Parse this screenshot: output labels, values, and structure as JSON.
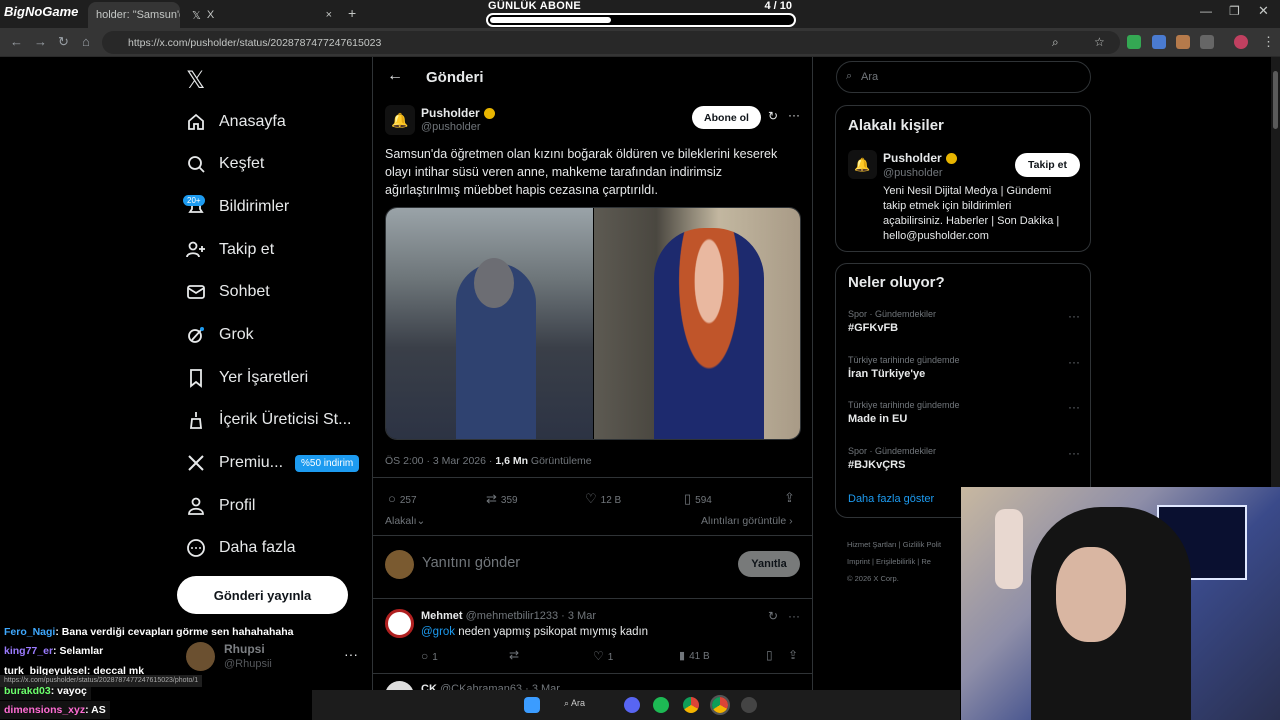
{
  "browser": {
    "tabs": [
      {
        "label": "holder: \"Samsun'da",
        "close": "×"
      },
      {
        "label": "X",
        "close": "×"
      }
    ],
    "new_tab": "+",
    "url": "https://x.com/pusholder/status/2028787477247615023",
    "status_url": "https://x.com/pusholder/status/2028787477247615023/photo/1",
    "overlay_logo": "BigNoGame"
  },
  "subs_goal": {
    "label": "GÜNLÜK ABONE",
    "count": "4  / 10",
    "progress": 0.4
  },
  "nav": {
    "logo": "𝕏",
    "items": [
      {
        "label": "Anasayfa",
        "icon": "home-icon"
      },
      {
        "label": "Keşfet",
        "icon": "search-icon"
      },
      {
        "label": "Bildirimler",
        "icon": "bell-icon"
      },
      {
        "label": "Takip et",
        "icon": "follow-icon"
      },
      {
        "label": "Sohbet",
        "icon": "mail-icon"
      },
      {
        "label": "Grok",
        "icon": "grok-icon"
      },
      {
        "label": "Yer İşaretleri",
        "icon": "bookmark-icon"
      },
      {
        "label": "İçerik Üreticisi St...",
        "icon": "creator-icon"
      },
      {
        "label": "Premiu...",
        "icon": "x-icon"
      },
      {
        "label": "Profil",
        "icon": "person-icon"
      },
      {
        "label": "Daha fazla",
        "icon": "more-icon"
      }
    ],
    "notif_badge": "20+",
    "premium_pill": "%50 indirim",
    "post_button": "Gönderi yayınla",
    "account": {
      "name": "Rhupsi",
      "handle": "@Rhupsii",
      "more": "···"
    }
  },
  "post": {
    "header_title": "Gönderi",
    "author": "Pusholder",
    "handle": "@pusholder",
    "subscribe": "Abone ol",
    "text": "Samsun'da öğretmen olan kızını boğarak öldüren ve bileklerini keserek olayı intihar süsü veren anne, mahkeme tarafından indirimsiz ağırlaştırılmış müebbet hapis cezasına çarptırıldı.",
    "time": "ÖS 2:00 · 3 Mar 2026 · ",
    "views_count": "1,6 Mn",
    "views_label": " Görüntüleme",
    "stats": {
      "replies": "257",
      "reposts": "359",
      "likes": "12 B",
      "bookmarks": "594"
    },
    "related": "Alakalı",
    "quotes_link": "Alıntıları görüntüle",
    "reply_placeholder": "Yanıtını gönder",
    "reply_button": "Yanıtla"
  },
  "reply1": {
    "author": "Mehmet",
    "handle": "@mehmetbilir1233 · 3 Mar",
    "mention": "@grok",
    "text": " neden yapmış psikopat mıymış kadın",
    "replies": "1",
    "likes": "1",
    "views": "41 B"
  },
  "reply2": {
    "author": "CK",
    "handle": "@CKahraman63 · 3 Mar"
  },
  "right": {
    "search_placeholder": "Ara",
    "related_title": "Alakalı kişiler",
    "person": {
      "name": "Pusholder",
      "handle": "@pusholder",
      "follow": "Takip et",
      "bio": "Yeni Nesil Dijital Medya | Gündemi takip etmek için bildirimleri açabilirsiniz. Haberler | Son Dakika | hello@pusholder.com"
    },
    "trends_title": "Neler oluyor?",
    "trends": [
      {
        "cat": "Spor · Gündemdekiler",
        "name": "#GFKvFB"
      },
      {
        "cat": "Türkiye tarihinde gündemde",
        "name": "İran Türkiye'ye"
      },
      {
        "cat": "Türkiye tarihinde gündemde",
        "name": "Made in EU"
      },
      {
        "cat": "Spor · Gündemdekiler",
        "name": "#BJKvÇRS"
      }
    ],
    "show_more": "Daha fazla göster",
    "footer": [
      "Hizmet Şartları",
      "Gizlilik Polit",
      "Imprint",
      "Erişilebilirlik",
      "Re",
      "© 2026 X Corp."
    ]
  },
  "chat": [
    {
      "user": "Fero_Nagi",
      "msg": " : Bana verdiği cevapları görme sen hahahahaha",
      "color": "#3fa9ff"
    },
    {
      "user": "king77_er",
      "msg": " : Selamlar",
      "color": "#9b7bff"
    },
    {
      "user": "turk_bilgeyuksel",
      "msg": " : deccal mk",
      "color": "#ffffff"
    },
    {
      "user": "burakd03",
      "msg": " : vayoç",
      "color": "#6cff6c"
    },
    {
      "user": "dimensions_xyz",
      "msg": " : AS",
      "color": "#ff6cd4"
    }
  ],
  "taskbar": {
    "search": "Ara"
  }
}
